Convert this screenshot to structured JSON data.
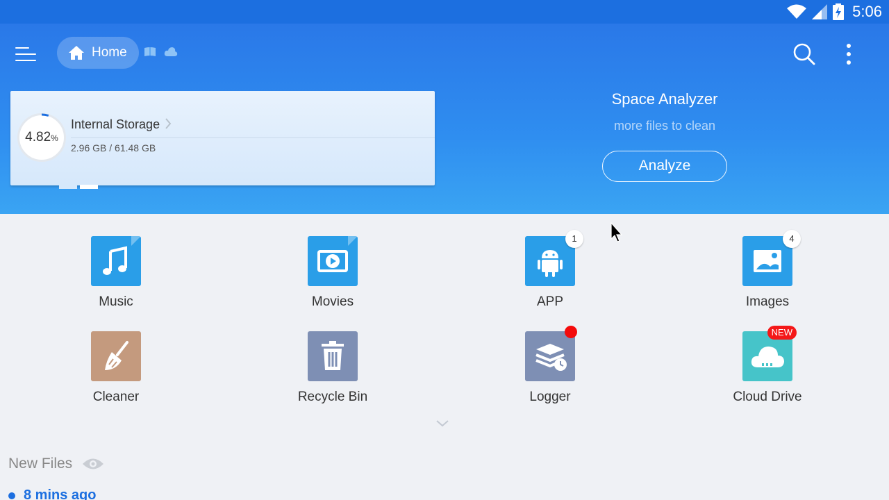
{
  "status_bar": {
    "time": "5:06"
  },
  "header": {
    "breadcrumb_home": "Home",
    "icons": [
      "menu-icon",
      "home-icon",
      "sd-card-icon",
      "cloud-icon",
      "search-icon",
      "more-vert-icon"
    ]
  },
  "storage": {
    "title": "Internal Storage",
    "percent": "4.82",
    "percent_sign": "%",
    "used_value": 0.0482,
    "size_text": "2.96 GB / 61.48 GB"
  },
  "analyzer": {
    "title": "Space Analyzer",
    "subtitle": "more files to clean",
    "button": "Analyze"
  },
  "categories": [
    {
      "label": "Music",
      "icon": "music-icon",
      "color": "#2a9ee8"
    },
    {
      "label": "Movies",
      "icon": "movie-icon",
      "color": "#2a9ee8"
    },
    {
      "label": "APP",
      "icon": "android-icon",
      "color": "#2a9ee8",
      "badge": "1"
    },
    {
      "label": "Images",
      "icon": "image-icon",
      "color": "#2a9ee8",
      "badge": "4"
    },
    {
      "label": "Cleaner",
      "icon": "broom-icon",
      "color": "#c49a7e"
    },
    {
      "label": "Recycle Bin",
      "icon": "trash-icon",
      "color": "#7e8fb4"
    },
    {
      "label": "Logger",
      "icon": "logger-icon",
      "color": "#7e8fb4",
      "dot": true
    },
    {
      "label": "Cloud Drive",
      "icon": "cloud-drive-icon",
      "color": "#46c4c9",
      "badge": "NEW"
    }
  ],
  "new_files": {
    "title": "New Files",
    "recent_label": "8 mins ago"
  },
  "colors": {
    "accent": "#1c6fe0",
    "header_top": "#2a78e8",
    "header_bottom": "#3aa4f3",
    "badge_red": "#f41818"
  }
}
